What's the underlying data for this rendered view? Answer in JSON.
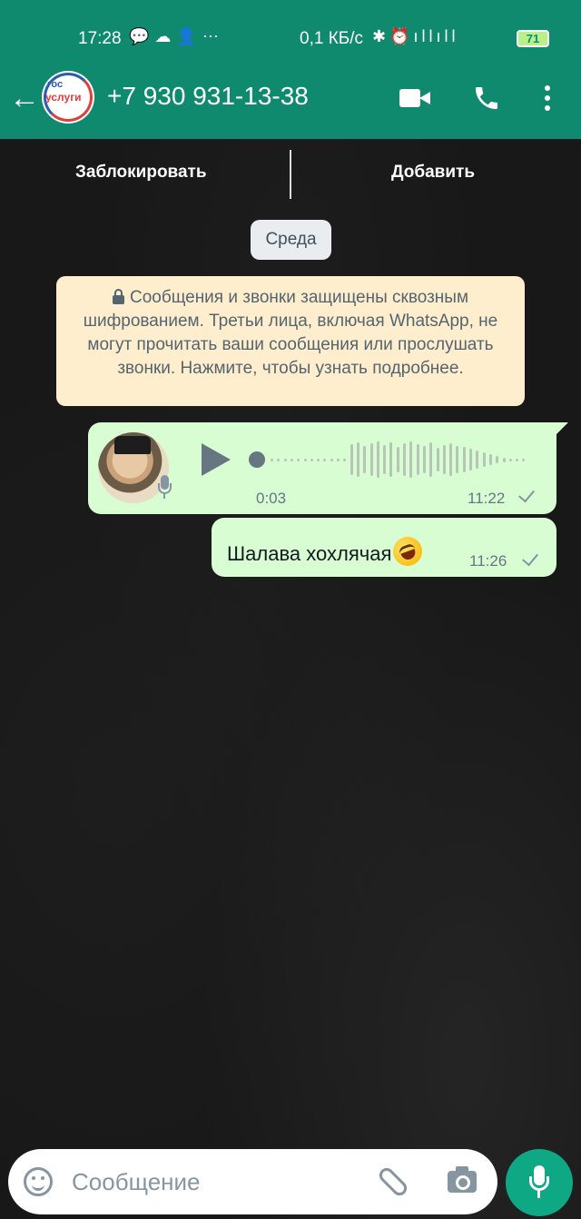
{
  "status_bar": {
    "time": "17:28",
    "left_icons": "💬☁👤⋯",
    "network_speed": "0,1 КБ/с",
    "right_icons": "✱⏰ıllıll",
    "battery": "71"
  },
  "header": {
    "back_glyph": "←",
    "avatar_logo_line1": "гос",
    "avatar_logo_line2": "услуги",
    "contact_name": "+7 930 931-13-38"
  },
  "action_bar": {
    "block_label": "Заблокировать",
    "add_label": "Добавить"
  },
  "chat": {
    "date_chip": "Среда",
    "encryption_notice": "Сообщения и звонки защищены сквозным шифрованием. Третьи лица, включая WhatsApp, не могут прочитать ваши сообщения или прослушать звонки. Нажмите, чтобы узнать подробнее.",
    "voice_message": {
      "duration": "0:03",
      "time": "11:22"
    },
    "text_message": {
      "text": "Шалава хохлячая",
      "time": "11:26"
    }
  },
  "composer": {
    "placeholder": "Сообщение"
  },
  "colors": {
    "header": "#0f8a6f",
    "bubble_out": "#d9fdd3",
    "notice": "#ffeecd",
    "mic_button": "#0fa884"
  }
}
